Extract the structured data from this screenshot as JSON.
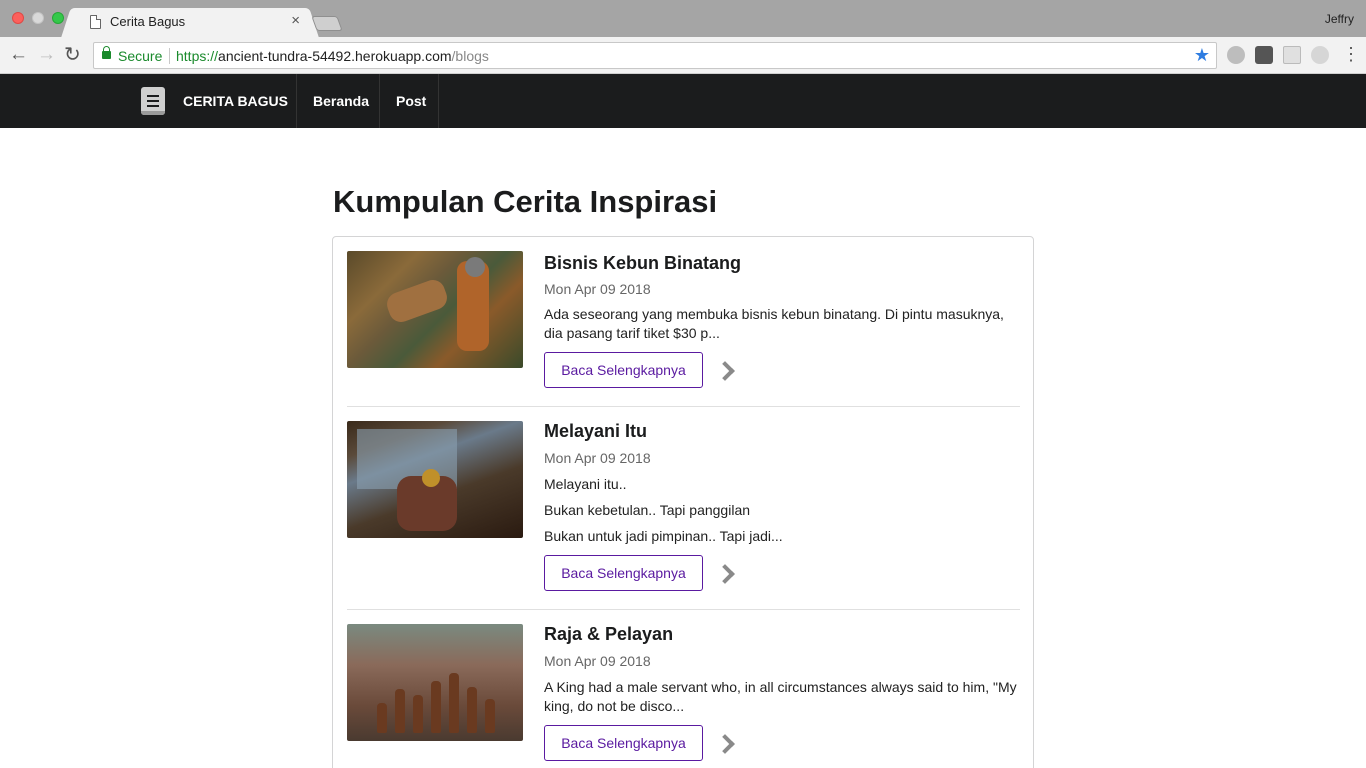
{
  "browser": {
    "tab_title": "Cerita Bagus",
    "tab_close": "×",
    "user_name": "Jeffry",
    "secure_label": "Secure",
    "url_scheme": "https://",
    "url_host": "ancient-tundra-54492.herokuapp.com",
    "url_path": "/blogs",
    "nav_back": "←",
    "nav_forward": "→",
    "nav_reload": "↻",
    "bookmark_star": "★",
    "menu": "⋮"
  },
  "site_nav": {
    "brand": "CERITA BAGUS",
    "items": [
      {
        "label": "Beranda"
      },
      {
        "label": "Post"
      }
    ]
  },
  "main": {
    "title": "Kumpulan Cerita Inspirasi",
    "posts": [
      {
        "title": "Bisnis Kebun Binatang",
        "date": "Mon Apr 09 2018",
        "excerpt": [
          "Ada seseorang yang membuka bisnis kebun binatang. Di pintu masuknya, dia pasang tarif tiket $30 p..."
        ],
        "button": "Baca Selengkapnya"
      },
      {
        "title": "Melayani Itu",
        "date": "Mon Apr 09 2018",
        "excerpt": [
          "Melayani itu..",
          "Bukan kebetulan.. Tapi panggilan",
          "Bukan untuk jadi pimpinan.. Tapi jadi..."
        ],
        "button": "Baca Selengkapnya"
      },
      {
        "title": "Raja & Pelayan",
        "date": "Mon Apr 09 2018",
        "excerpt": [
          "A King had a male servant who, in all circumstances always said to him, \"My king, do not be disco..."
        ],
        "button": "Baca Selengkapnya"
      }
    ]
  },
  "colors": {
    "navbar_bg": "#1b1c1d",
    "button_accent": "#5a1aa0",
    "secure_green": "#1a8a2c",
    "star_blue": "#2f7de1"
  }
}
